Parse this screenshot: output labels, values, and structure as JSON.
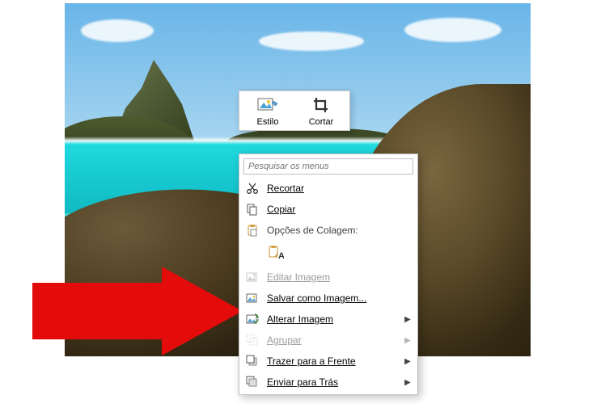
{
  "mini_toolbar": {
    "style_label": "Estilo",
    "crop_label": "Cortar"
  },
  "context_menu": {
    "search_placeholder": "Pesquisar os menus",
    "cut": "Recortar",
    "copy": "Copiar",
    "paste_options_label": "Opções de Colagem:",
    "paste_keep_format_tooltip": "A",
    "edit_image": "Editar Imagem",
    "save_as_image": "Salvar como Imagem...",
    "change_image": "Alterar Imagem",
    "group": "Agrupar",
    "bring_to_front": "Trazer para a Frente",
    "send_to_back": "Enviar para Trás"
  }
}
